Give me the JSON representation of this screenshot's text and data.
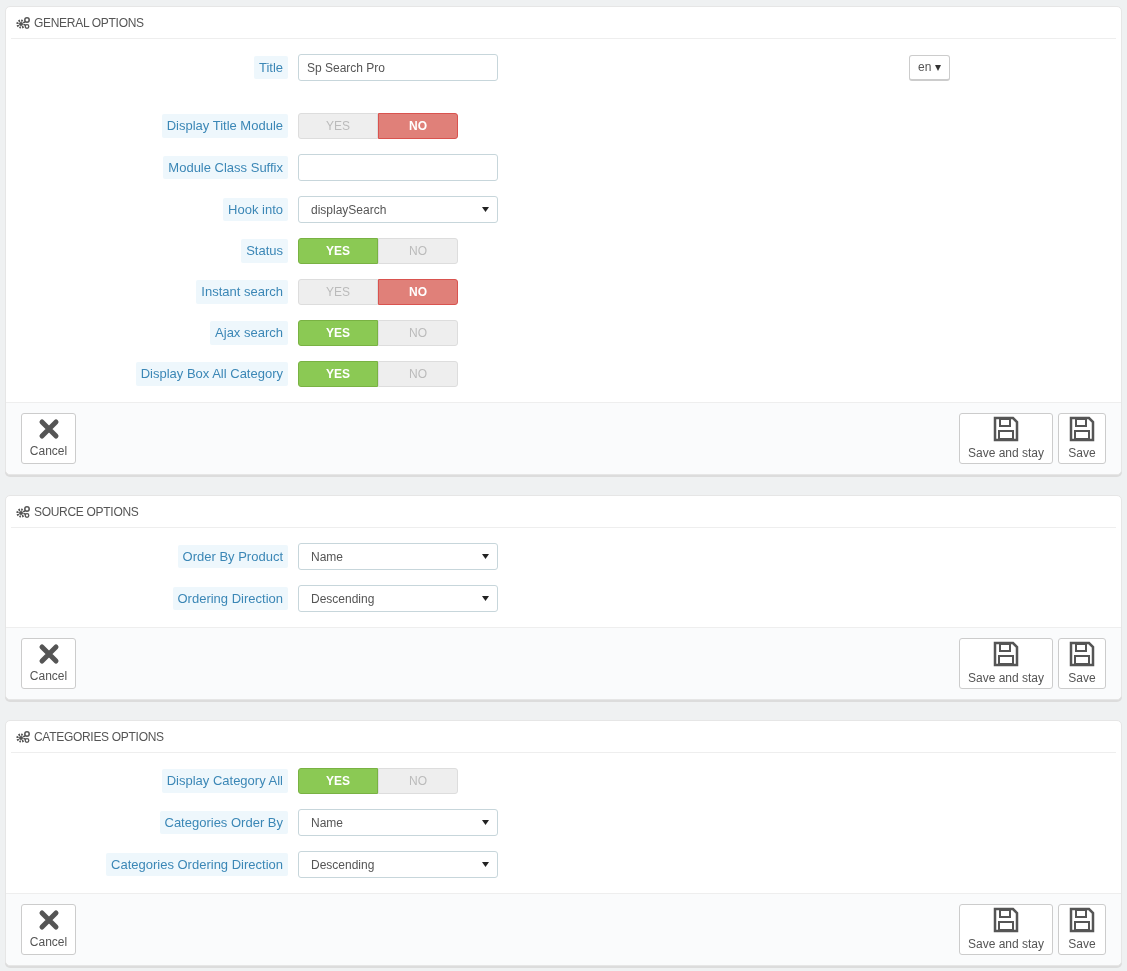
{
  "panels": [
    {
      "title": "GENERAL OPTIONS",
      "fields": [
        {
          "kind": "text",
          "label": "Title",
          "value": "Sp Search Pro",
          "language": "en",
          "language_caret": "▾"
        },
        {
          "kind": "switch",
          "label": "Display Title Module",
          "yes": "YES",
          "no": "NO",
          "on": false
        },
        {
          "kind": "text",
          "label": "Module Class Suffix"
        },
        {
          "kind": "select",
          "label": "Hook into",
          "value": "displaySearch"
        },
        {
          "kind": "switch",
          "label": "Status",
          "yes": "YES",
          "no": "NO",
          "on": true
        },
        {
          "kind": "switch",
          "label": "Instant search",
          "yes": "YES",
          "no": "NO",
          "on": false
        },
        {
          "kind": "switch",
          "label": "Ajax search",
          "yes": "YES",
          "no": "NO",
          "on": true
        },
        {
          "kind": "switch",
          "label": "Display Box All Category",
          "yes": "YES",
          "no": "NO",
          "on": true
        }
      ],
      "cancel": "Cancel",
      "save_stay": "Save and stay",
      "save": "Save"
    },
    {
      "title": "SOURCE OPTIONS",
      "fields": [
        {
          "kind": "select",
          "label": "Order By Product",
          "value": "Name"
        },
        {
          "kind": "select",
          "label": "Ordering Direction",
          "value": "Descending"
        }
      ],
      "cancel": "Cancel",
      "save_stay": "Save and stay",
      "save": "Save"
    },
    {
      "title": "CATEGORIES OPTIONS",
      "fields": [
        {
          "kind": "switch",
          "label": "Display Category All",
          "yes": "YES",
          "no": "NO",
          "on": true
        },
        {
          "kind": "select",
          "label": "Categories Order By",
          "value": "Name"
        },
        {
          "kind": "select",
          "label": "Categories Ordering Direction",
          "value": "Descending"
        }
      ],
      "cancel": "Cancel",
      "save_stay": "Save and stay",
      "save": "Save"
    }
  ]
}
